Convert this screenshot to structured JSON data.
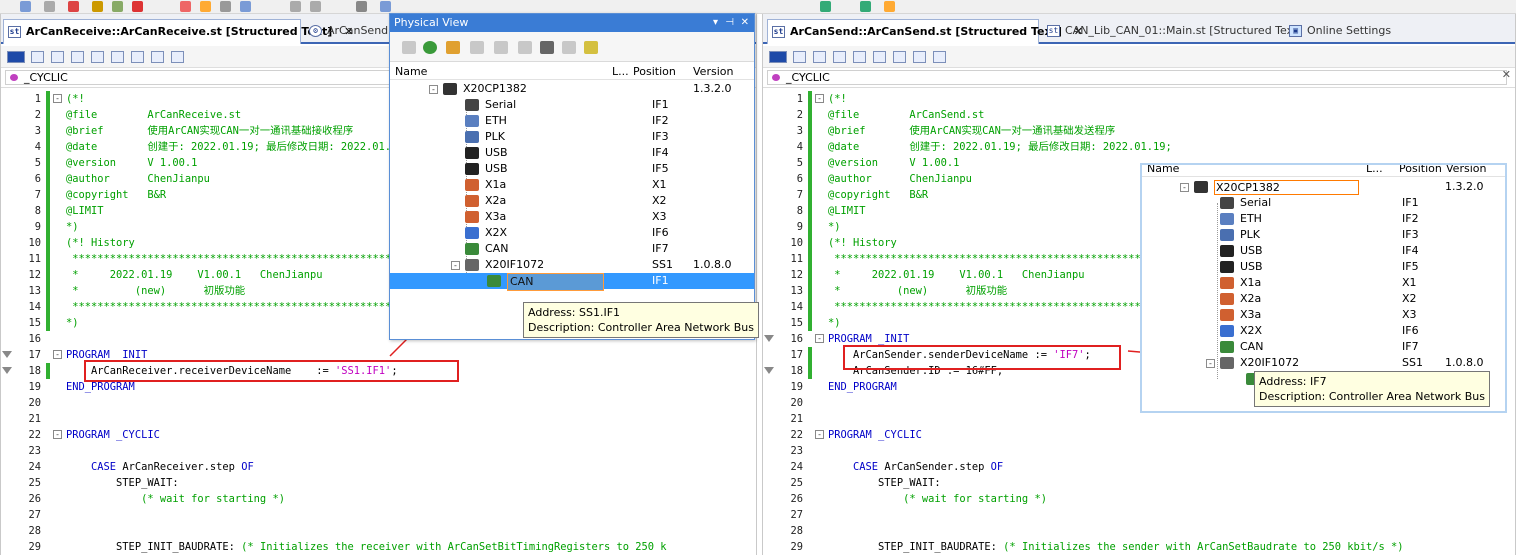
{
  "left_editor": {
    "tabs": [
      {
        "label": "ArCanReceive::ArCanReceive.st [Structured Text]",
        "active": true
      },
      {
        "label": "ArCanSend::..."
      }
    ],
    "cyclic_selector": "_CYCLIC",
    "lines": [
      {
        "n": "1",
        "fold": "-",
        "parts": [
          {
            "t": "(*!",
            "c": "com"
          }
        ]
      },
      {
        "n": "2",
        "parts": [
          {
            "t": "@file        ArCanReceive.st",
            "c": "com"
          }
        ]
      },
      {
        "n": "3",
        "parts": [
          {
            "t": "@brief       使用ArCAN实现CAN一对一通讯基础接收程序",
            "c": "com"
          }
        ]
      },
      {
        "n": "4",
        "parts": [
          {
            "t": "@date        创建于: 2022.01.19; 最后修改日期: 2022.01.19;",
            "c": "com"
          }
        ]
      },
      {
        "n": "5",
        "parts": [
          {
            "t": "@version     V 1.00.1",
            "c": "com"
          }
        ]
      },
      {
        "n": "6",
        "parts": [
          {
            "t": "@author      ChenJianpu",
            "c": "com"
          }
        ]
      },
      {
        "n": "7",
        "parts": [
          {
            "t": "@copyright   B&R",
            "c": "com"
          }
        ]
      },
      {
        "n": "8",
        "parts": [
          {
            "t": "@LIMIT",
            "c": "com"
          }
        ]
      },
      {
        "n": "9",
        "parts": [
          {
            "t": "*)",
            "c": "com"
          }
        ]
      },
      {
        "n": "10",
        "parts": [
          {
            "t": "(*! History",
            "c": "com"
          }
        ]
      },
      {
        "n": "11",
        "parts": [
          {
            "t": " ****************************************************************************",
            "c": "com"
          }
        ]
      },
      {
        "n": "12",
        "parts": [
          {
            "t": " *     2022.01.19    V1.00.1   ChenJianpu",
            "c": "com"
          }
        ]
      },
      {
        "n": "13",
        "parts": [
          {
            "t": " *         (new)      初版功能",
            "c": "com"
          }
        ]
      },
      {
        "n": "14",
        "parts": [
          {
            "t": " ****************************************************************************",
            "c": "com"
          }
        ]
      },
      {
        "n": "15",
        "parts": [
          {
            "t": "*)",
            "c": "com"
          }
        ]
      },
      {
        "n": "16",
        "parts": []
      },
      {
        "n": "17",
        "fold": "-",
        "parts": [
          {
            "t": "PROGRAM _INIT",
            "c": "kw"
          }
        ]
      },
      {
        "n": "18",
        "parts": [
          {
            "t": "    ArCanReceiver.receiverDeviceName    := ",
            "c": "txt"
          },
          {
            "t": "'SS1.IF1'",
            "c": "str"
          },
          {
            "t": ";",
            "c": "txt"
          }
        ]
      },
      {
        "n": "19",
        "parts": [
          {
            "t": "END_PROGRAM",
            "c": "kw"
          }
        ]
      },
      {
        "n": "20",
        "parts": []
      },
      {
        "n": "21",
        "parts": []
      },
      {
        "n": "22",
        "fold": "-",
        "parts": [
          {
            "t": "PROGRAM _CYCLIC",
            "c": "kw"
          }
        ]
      },
      {
        "n": "23",
        "parts": []
      },
      {
        "n": "24",
        "parts": [
          {
            "t": "    ",
            "c": "txt"
          },
          {
            "t": "CASE",
            "c": "kw"
          },
          {
            "t": " ArCanReceiver.step ",
            "c": "txt"
          },
          {
            "t": "OF",
            "c": "kw"
          }
        ]
      },
      {
        "n": "25",
        "parts": [
          {
            "t": "        STEP_WAIT:",
            "c": "txt"
          }
        ]
      },
      {
        "n": "26",
        "parts": [
          {
            "t": "            (* wait for starting *)",
            "c": "com"
          }
        ]
      },
      {
        "n": "27",
        "parts": []
      },
      {
        "n": "28",
        "parts": []
      },
      {
        "n": "29",
        "parts": [
          {
            "t": "        STEP_INIT_BAUDRATE: ",
            "c": "txt"
          },
          {
            "t": "(* Initializes the receiver with ArCanSetBitTimingRegisters to 250 k",
            "c": "com"
          }
        ]
      }
    ]
  },
  "right_editor": {
    "tabs": [
      {
        "label": "ArCanSend::ArCanSend.st [Structured Text]",
        "active": true
      },
      {
        "label": "CAN_Lib_CAN_01::Main.st [Structured Text]"
      },
      {
        "label": "Online Settings"
      }
    ],
    "cyclic_selector": "_CYCLIC",
    "lines": [
      {
        "n": "1",
        "fold": "-",
        "parts": [
          {
            "t": "(*!",
            "c": "com"
          }
        ]
      },
      {
        "n": "2",
        "parts": [
          {
            "t": "@file        ArCanSend.st",
            "c": "com"
          }
        ]
      },
      {
        "n": "3",
        "parts": [
          {
            "t": "@brief       使用ArCAN实现CAN一对一通讯基础发送程序",
            "c": "com"
          }
        ]
      },
      {
        "n": "4",
        "parts": [
          {
            "t": "@date        创建于: 2022.01.19; 最后修改日期: 2022.01.19;",
            "c": "com"
          }
        ]
      },
      {
        "n": "5",
        "parts": [
          {
            "t": "@version     V 1.00.1",
            "c": "com"
          }
        ]
      },
      {
        "n": "6",
        "parts": [
          {
            "t": "@author      ChenJianpu",
            "c": "com"
          }
        ]
      },
      {
        "n": "7",
        "parts": [
          {
            "t": "@copyright   B&R",
            "c": "com"
          }
        ]
      },
      {
        "n": "8",
        "parts": [
          {
            "t": "@LIMIT",
            "c": "com"
          }
        ]
      },
      {
        "n": "9",
        "parts": [
          {
            "t": "*)",
            "c": "com"
          }
        ]
      },
      {
        "n": "10",
        "parts": [
          {
            "t": "(*! History",
            "c": "com"
          }
        ]
      },
      {
        "n": "11",
        "parts": [
          {
            "t": " ****************************************************************************",
            "c": "com"
          }
        ]
      },
      {
        "n": "12",
        "parts": [
          {
            "t": " *     2022.01.19    V1.00.1   ChenJianpu",
            "c": "com"
          }
        ]
      },
      {
        "n": "13",
        "parts": [
          {
            "t": " *         (new)      初版功能",
            "c": "com"
          }
        ]
      },
      {
        "n": "14",
        "parts": [
          {
            "t": " ****************************************************************************",
            "c": "com"
          }
        ]
      },
      {
        "n": "15",
        "parts": [
          {
            "t": "*)",
            "c": "com"
          }
        ]
      },
      {
        "n": "16",
        "fold": "-",
        "parts": [
          {
            "t": "PROGRAM _INIT",
            "c": "kw"
          }
        ]
      },
      {
        "n": "17",
        "parts": [
          {
            "t": "    ArCanSender.senderDeviceName := ",
            "c": "txt"
          },
          {
            "t": "'IF7'",
            "c": "str"
          },
          {
            "t": ";",
            "c": "txt"
          }
        ]
      },
      {
        "n": "18",
        "parts": [
          {
            "t": "    ArCanSender.ID := 16#FF;",
            "c": "txt"
          }
        ]
      },
      {
        "n": "19",
        "parts": [
          {
            "t": "END_PROGRAM",
            "c": "kw"
          }
        ]
      },
      {
        "n": "20",
        "parts": []
      },
      {
        "n": "21",
        "parts": []
      },
      {
        "n": "22",
        "fold": "-",
        "parts": [
          {
            "t": "PROGRAM _CYCLIC",
            "c": "kw"
          }
        ]
      },
      {
        "n": "23",
        "parts": []
      },
      {
        "n": "24",
        "parts": [
          {
            "t": "    ",
            "c": "txt"
          },
          {
            "t": "CASE",
            "c": "kw"
          },
          {
            "t": " ArCanSender.step ",
            "c": "txt"
          },
          {
            "t": "OF",
            "c": "kw"
          }
        ]
      },
      {
        "n": "25",
        "parts": [
          {
            "t": "        STEP_WAIT:",
            "c": "txt"
          }
        ]
      },
      {
        "n": "26",
        "parts": [
          {
            "t": "            (* wait for starting *)",
            "c": "com"
          }
        ]
      },
      {
        "n": "27",
        "parts": []
      },
      {
        "n": "28",
        "parts": []
      },
      {
        "n": "29",
        "parts": [
          {
            "t": "        STEP_INIT_BAUDRATE: ",
            "c": "txt"
          },
          {
            "t": "(* Initializes the sender with ArCanSetBaudrate to 250 kbit/s *)",
            "c": "com"
          }
        ]
      }
    ]
  },
  "physical_view": {
    "title": "Physical View",
    "columns": {
      "name": "Name",
      "l": "L...",
      "position": "Position",
      "version": "Version"
    },
    "rows": [
      {
        "name": "X20CP1382",
        "pos": "",
        "ver": "1.3.2.0",
        "icon": "cpu-icon",
        "level": 0,
        "exp": "-"
      },
      {
        "name": "Serial",
        "pos": "IF1",
        "ver": "",
        "icon": "serial-icon",
        "level": 1
      },
      {
        "name": "ETH",
        "pos": "IF2",
        "ver": "",
        "icon": "eth-icon",
        "level": 1
      },
      {
        "name": "PLK",
        "pos": "IF3",
        "ver": "",
        "icon": "plk-icon",
        "level": 1
      },
      {
        "name": "USB",
        "pos": "IF4",
        "ver": "",
        "icon": "usb-icon",
        "level": 1
      },
      {
        "name": "USB",
        "pos": "IF5",
        "ver": "",
        "icon": "usb-icon",
        "level": 1
      },
      {
        "name": "X1a",
        "pos": "X1",
        "ver": "",
        "icon": "plug-icon",
        "level": 1
      },
      {
        "name": "X2a",
        "pos": "X2",
        "ver": "",
        "icon": "plug-icon",
        "level": 1
      },
      {
        "name": "X3a",
        "pos": "X3",
        "ver": "",
        "icon": "plug-icon",
        "level": 1
      },
      {
        "name": "X2X",
        "pos": "IF6",
        "ver": "",
        "icon": "x2x-icon",
        "level": 1
      },
      {
        "name": "CAN",
        "pos": "IF7",
        "ver": "",
        "icon": "can-icon",
        "level": 1
      },
      {
        "name": "X20IF1072",
        "pos": "SS1",
        "ver": "1.0.8.0",
        "icon": "module-icon",
        "level": 1,
        "exp": "-"
      },
      {
        "name": "CAN",
        "pos": "IF1",
        "ver": "",
        "icon": "can-icon",
        "level": 2,
        "selected": true
      }
    ],
    "tooltip": {
      "line1": "Address: SS1.IF1",
      "line2": "Description: Controller Area Network Bus"
    }
  },
  "overlay_tree": {
    "columns": {
      "name": "Name",
      "l": "L...",
      "position": "Position",
      "version": "Version"
    },
    "rows": [
      {
        "name": "X20CP1382",
        "pos": "",
        "ver": "1.3.2.0",
        "icon": "cpu-icon",
        "level": 0,
        "exp": "-",
        "boxed": true
      },
      {
        "name": "Serial",
        "pos": "IF1",
        "ver": "",
        "icon": "serial-icon",
        "level": 1
      },
      {
        "name": "ETH",
        "pos": "IF2",
        "ver": "",
        "icon": "eth-icon",
        "level": 1
      },
      {
        "name": "PLK",
        "pos": "IF3",
        "ver": "",
        "icon": "plk-icon",
        "level": 1
      },
      {
        "name": "USB",
        "pos": "IF4",
        "ver": "",
        "icon": "usb-icon",
        "level": 1
      },
      {
        "name": "USB",
        "pos": "IF5",
        "ver": "",
        "icon": "usb-icon",
        "level": 1
      },
      {
        "name": "X1a",
        "pos": "X1",
        "ver": "",
        "icon": "plug-icon",
        "level": 1
      },
      {
        "name": "X2a",
        "pos": "X2",
        "ver": "",
        "icon": "plug-icon",
        "level": 1
      },
      {
        "name": "X3a",
        "pos": "X3",
        "ver": "",
        "icon": "plug-icon",
        "level": 1
      },
      {
        "name": "X2X",
        "pos": "IF6",
        "ver": "",
        "icon": "x2x-icon",
        "level": 1
      },
      {
        "name": "CAN",
        "pos": "IF7",
        "ver": "",
        "icon": "can-icon",
        "level": 1
      },
      {
        "name": "X20IF1072",
        "pos": "SS1",
        "ver": "1.0.8.0",
        "icon": "module-icon",
        "level": 1,
        "exp": "-"
      },
      {
        "name": "",
        "pos": "",
        "ver": "",
        "icon": "can-icon",
        "level": 2
      }
    ],
    "tooltip": {
      "line1": "Address: IF7",
      "line2": "Description: Controller Area Network Bus"
    }
  },
  "colors": {
    "comment": "#00a000",
    "keyword": "#0000c8",
    "string": "#c000c0",
    "highlight": "#e02020",
    "selection": "#3399ff",
    "title_bar": "#3a7cd5"
  }
}
